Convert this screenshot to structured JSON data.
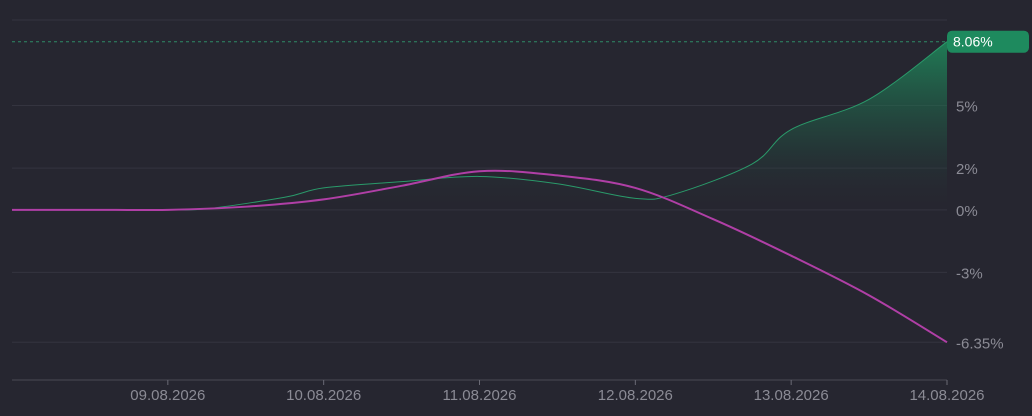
{
  "chart_data": {
    "type": "area",
    "title": "",
    "xlabel": "",
    "ylabel": "",
    "x_ticks": [
      "09.08.2026",
      "10.08.2026",
      "11.08.2026",
      "12.08.2026",
      "13.08.2026",
      "14.08.2026"
    ],
    "y_ticks": [
      {
        "value": 5,
        "label": "5%"
      },
      {
        "value": 2,
        "label": "2%"
      },
      {
        "value": 0,
        "label": "0%"
      },
      {
        "value": -3,
        "label": "-3%"
      },
      {
        "value": -6.35,
        "label": "-6.35%"
      }
    ],
    "ylim": [
      -7.2,
      9.1
    ],
    "grid": true,
    "series": [
      {
        "color": "#2a9a6a",
        "fill": true,
        "points": [
          [
            "08.08.2026 00:00",
            0
          ],
          [
            "08.08.2026 12:00",
            0
          ],
          [
            "09.08.2026 00:00",
            0
          ],
          [
            "09.08.2026 06:00",
            0.05
          ],
          [
            "09.08.2026 18:00",
            0.6
          ],
          [
            "10.08.2026 00:00",
            1.05
          ],
          [
            "10.08.2026 12:00",
            1.35
          ],
          [
            "11.08.2026 00:00",
            1.6
          ],
          [
            "11.08.2026 12:00",
            1.25
          ],
          [
            "12.08.2026 00:00",
            0.55
          ],
          [
            "12.08.2026 06:00",
            0.75
          ],
          [
            "12.08.2026 18:00",
            2.2
          ],
          [
            "13.08.2026 00:00",
            3.85
          ],
          [
            "13.08.2026 12:00",
            5.3
          ],
          [
            "14.08.2026 00:00",
            8.06
          ]
        ]
      },
      {
        "color": "#b03fa6",
        "fill": false,
        "points": [
          [
            "08.08.2026 00:00",
            0
          ],
          [
            "08.08.2026 12:00",
            0
          ],
          [
            "09.08.2026 00:00",
            0
          ],
          [
            "09.08.2026 12:00",
            0.15
          ],
          [
            "10.08.2026 00:00",
            0.5
          ],
          [
            "10.08.2026 12:00",
            1.15
          ],
          [
            "11.08.2026 00:00",
            1.85
          ],
          [
            "11.08.2026 12:00",
            1.65
          ],
          [
            "12.08.2026 00:00",
            1.05
          ],
          [
            "12.08.2026 12:00",
            -0.45
          ],
          [
            "13.08.2026 00:00",
            -2.2
          ],
          [
            "13.08.2026 12:00",
            -4.1
          ],
          [
            "14.08.2026 00:00",
            -6.35
          ]
        ]
      }
    ],
    "last_value_label": "8.06%",
    "badge_color": "#1e8a5e",
    "reference_line_value": 8.06
  }
}
